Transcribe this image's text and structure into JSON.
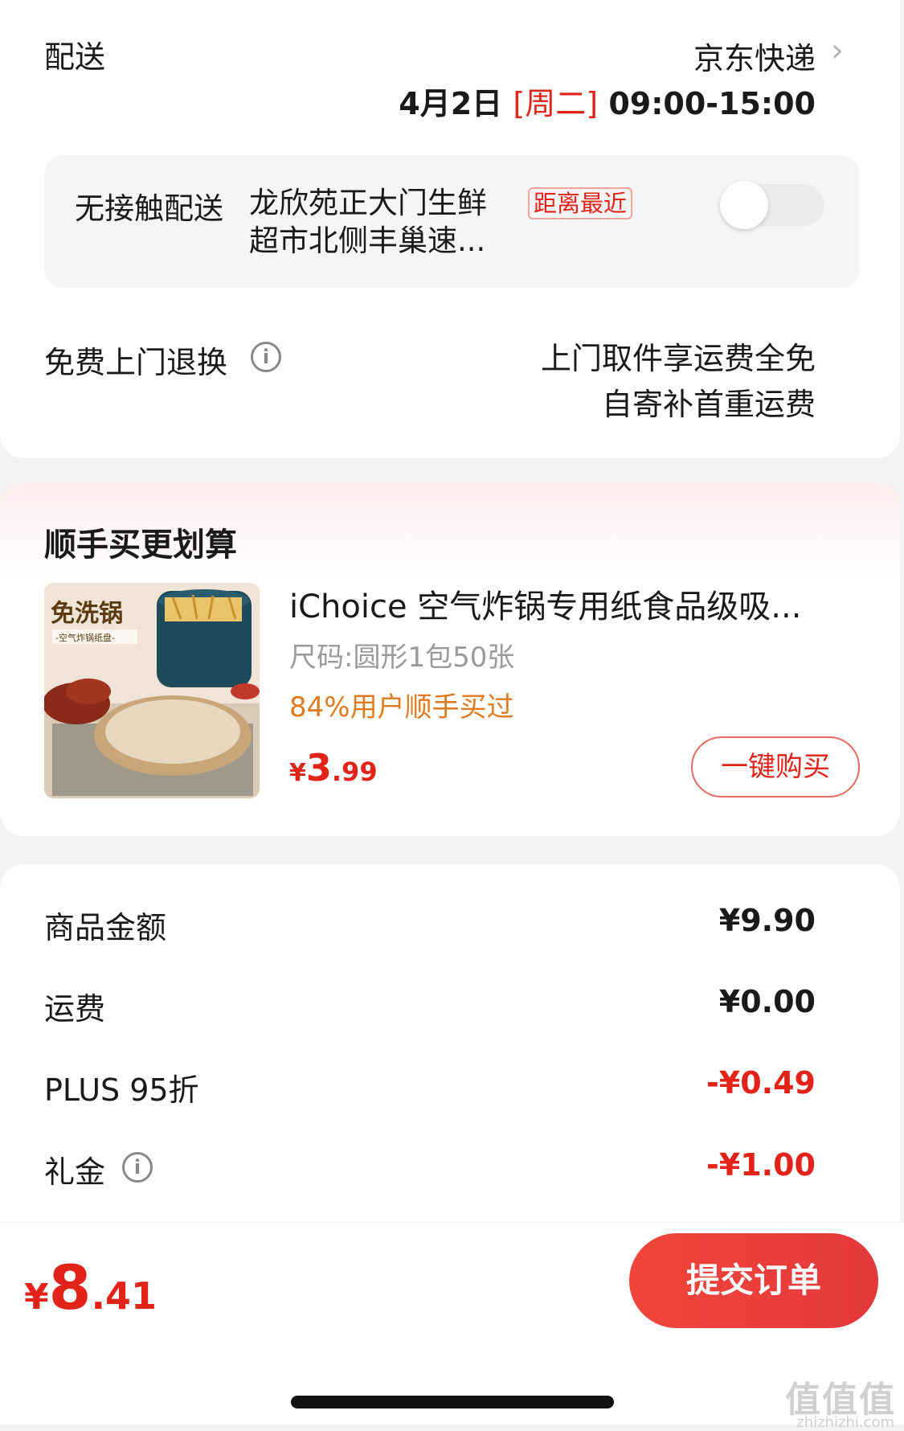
{
  "delivery": {
    "label": "配送",
    "courier": "京东快递",
    "date": "4月2日",
    "weekday": "[周二]",
    "time_window": "09:00-15:00"
  },
  "contactless": {
    "label": "无接触配送",
    "address": "龙欣苑正大门生鲜超市北侧丰巢速...",
    "badge": "距离最近",
    "enabled": false
  },
  "returns": {
    "label": "免费上门退换",
    "info_icon": "i",
    "line1": "上门取件享运费全免",
    "line2": "自寄补首重运费"
  },
  "upsell": {
    "title": "顺手买更划算",
    "product_name": "iChoice 空气炸锅专用纸食品级吸...",
    "spec": "尺码:圆形1包50张",
    "bought_ratio": "84%用户顺手买过",
    "price_symbol": "¥",
    "price_int": "3",
    "price_dec": ".99",
    "buy_button": "一键购买",
    "image_text_main": "免洗锅",
    "image_text_sub": "-空气炸锅纸盘-"
  },
  "summary": {
    "rows": [
      {
        "label": "商品金额",
        "value": "¥9.90"
      },
      {
        "label": "运费",
        "value": "¥0.00"
      },
      {
        "label": "PLUS 95折",
        "value": "-¥0.49"
      },
      {
        "label": "礼金",
        "value": "-¥1.00"
      }
    ]
  },
  "footer": {
    "total_symbol": "¥",
    "total_int": "8",
    "total_dec": ".41",
    "submit": "提交订单",
    "watermark": "值值值",
    "watermark_url": "zhizhizhi.com"
  },
  "colors": {
    "accent_red": "#e2231a",
    "orange": "#e07a1f"
  }
}
